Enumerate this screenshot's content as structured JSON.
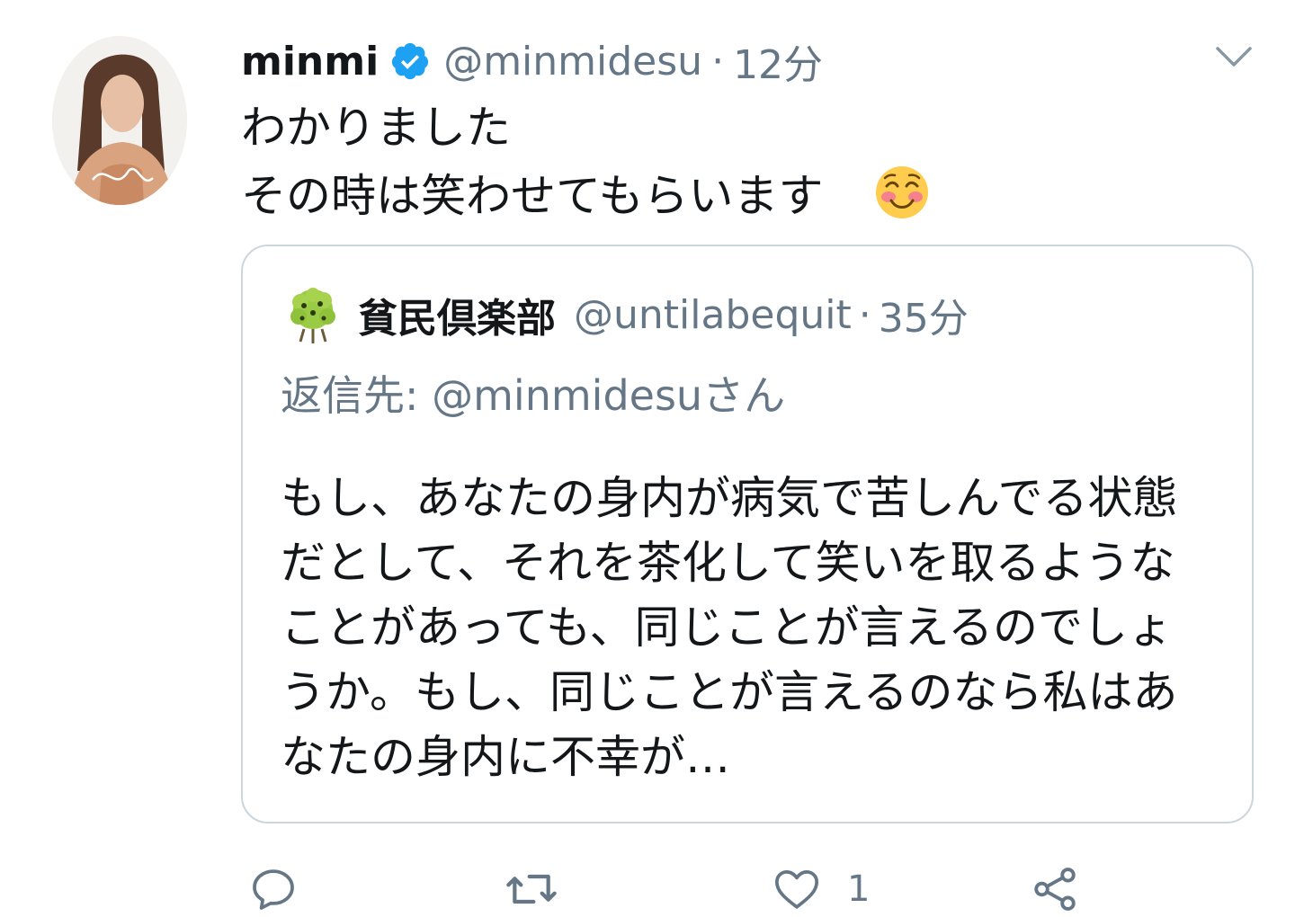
{
  "tweet": {
    "display_name": "minmi",
    "handle": "@minmidesu",
    "separator": "·",
    "time": "12分",
    "lines": [
      "わかりました",
      "その時は笑わせてもらいます"
    ],
    "emoji": "smiling-face-with-blush-emoji"
  },
  "quote": {
    "display_name": "貧民倶楽部",
    "handle": "@untilabequit",
    "separator": "·",
    "time": "35分",
    "reply_label": "返信先:",
    "reply_handle": "@minmidesuさん",
    "text": "もし、あなたの身内が病気で苦しんでる状態だとして、それを茶化して笑いを取るようなことがあっても、同じことが言えるのでしょうか。もし、同じことが言えるのなら私はあなたの身内に不幸が…"
  },
  "actions": {
    "like_count": "1",
    "icons": [
      "reply-icon",
      "retweet-icon",
      "like-icon",
      "share-icon"
    ]
  },
  "colors": {
    "primary_text": "#14171a",
    "secondary_text": "#657786",
    "border": "#ccd6dd",
    "verified": "#1da1f2"
  }
}
